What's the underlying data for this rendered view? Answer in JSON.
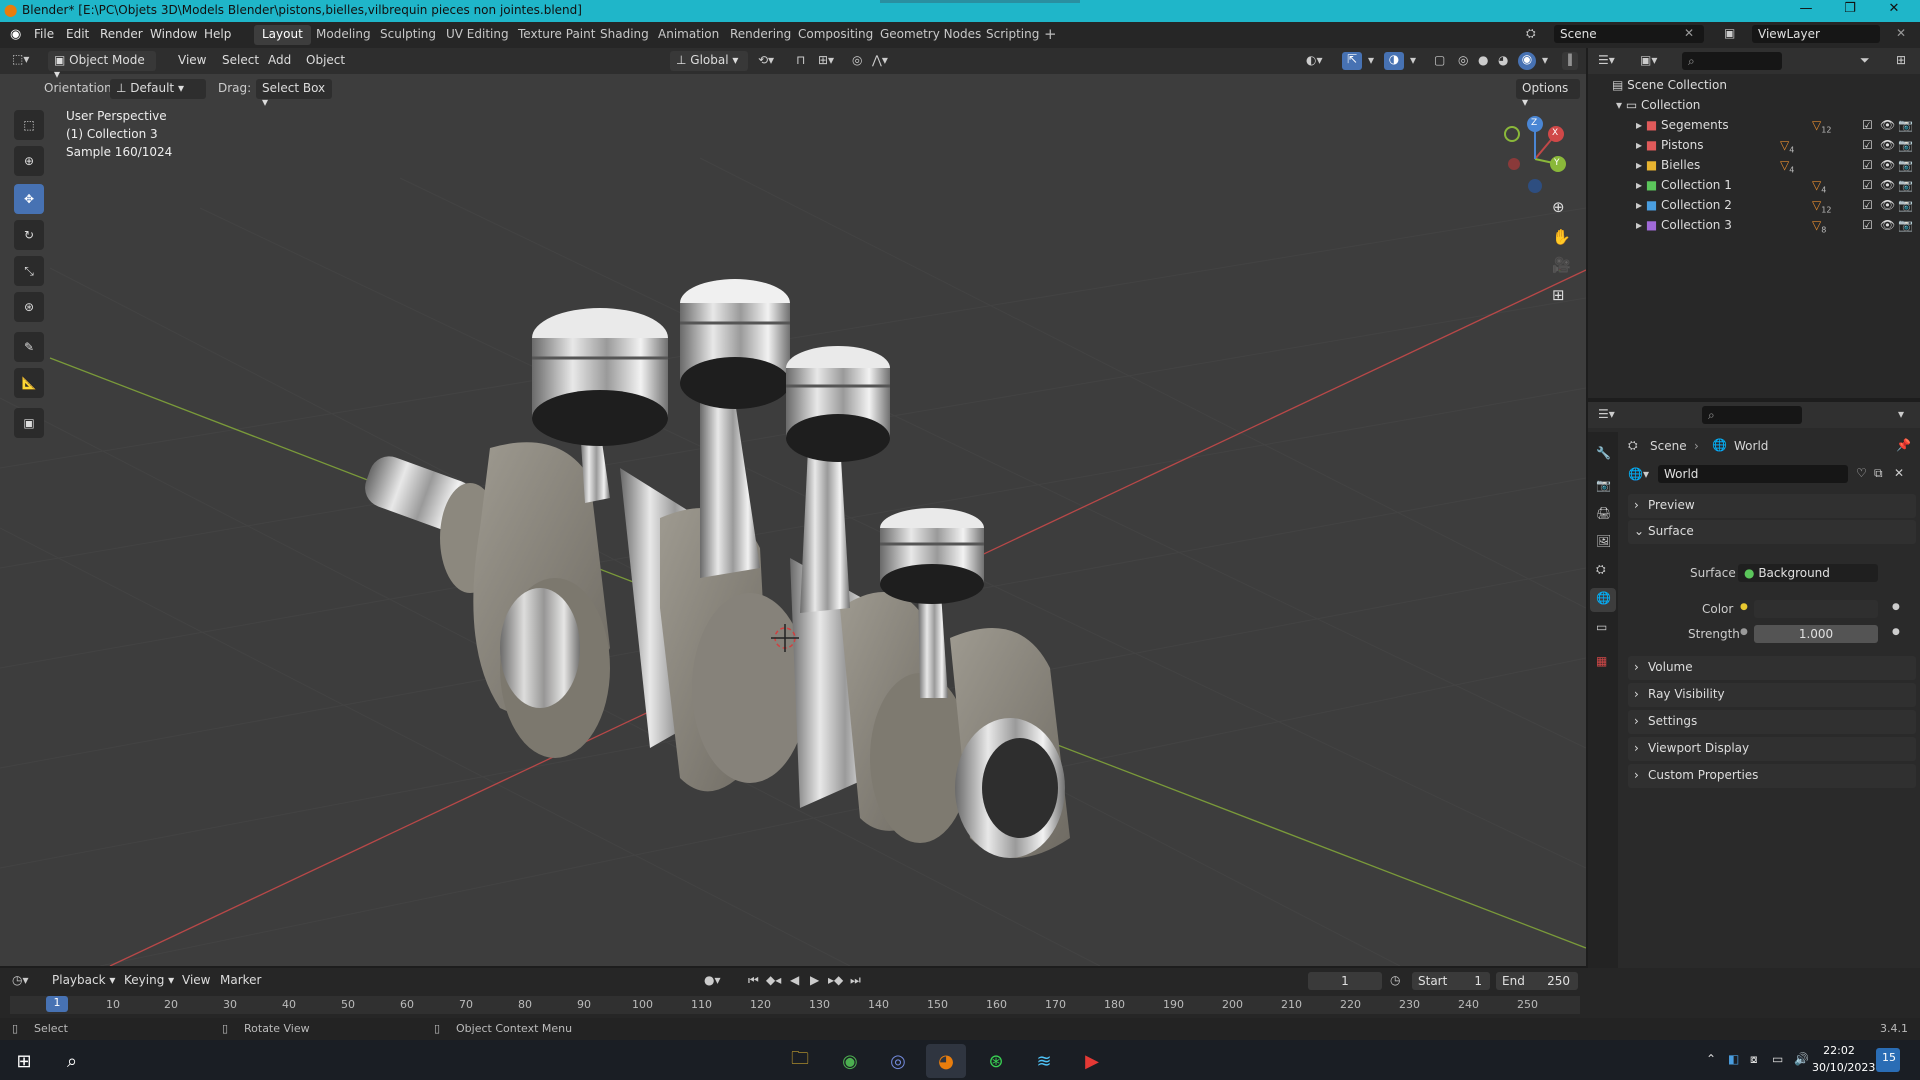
{
  "window": {
    "title": "Blender* [E:\\PC\\Objets 3D\\Models Blender\\pistons,bielles,vilbrequin pieces non jointes.blend]",
    "minimize": "—",
    "maximize": "❐",
    "close": "✕"
  },
  "menu": {
    "file": "File",
    "edit": "Edit",
    "render": "Render",
    "window": "Window",
    "help": "Help"
  },
  "workspaces": [
    "Layout",
    "Modeling",
    "Sculpting",
    "UV Editing",
    "Texture Paint",
    "Shading",
    "Animation",
    "Rendering",
    "Compositing",
    "Geometry Nodes",
    "Scripting"
  ],
  "topright": {
    "scene": "Scene",
    "view_layer": "ViewLayer"
  },
  "viewport_header": {
    "mode": "Object Mode",
    "view": "View",
    "select": "Select",
    "add": "Add",
    "object": "Object",
    "transform_orientation": "Global",
    "orientation_label": "Orientation:",
    "orientation_value": "Default",
    "drag_label": "Drag:",
    "drag_value": "Select Box",
    "options": "Options"
  },
  "viewport_overlay": {
    "perspective": "User Perspective",
    "collection": "(1) Collection 3",
    "sample": "Sample 160/1024"
  },
  "gizmo": {
    "x": "X",
    "y": "Y",
    "z": "Z"
  },
  "outliner": {
    "scene_collection": "Scene Collection",
    "collection": "Collection",
    "items": [
      {
        "name": "Segements",
        "count": "12",
        "color": "#e05a5a"
      },
      {
        "name": "Pistons",
        "count": "4",
        "color": "#e05a5a"
      },
      {
        "name": "Bielles",
        "count": "4",
        "color": "#e8b430"
      },
      {
        "name": "Collection 1",
        "count": "4",
        "color": "#5bc65b"
      },
      {
        "name": "Collection 2",
        "count": "12",
        "color": "#4a9ee0"
      },
      {
        "name": "Collection 3",
        "count": "8",
        "color": "#a06ad8"
      }
    ]
  },
  "properties": {
    "breadcrumb_scene": "Scene",
    "breadcrumb_world": "World",
    "world_name": "World",
    "sections": {
      "preview": "Preview",
      "surface": "Surface",
      "volume": "Volume",
      "ray_visibility": "Ray Visibility",
      "settings": "Settings",
      "viewport_display": "Viewport Display",
      "custom_properties": "Custom Properties"
    },
    "surface_label": "Surface",
    "surface_value": "Background",
    "color_label": "Color",
    "strength_label": "Strength",
    "strength_value": "1.000"
  },
  "timeline": {
    "playback": "Playback",
    "keying": "Keying",
    "view": "View",
    "marker": "Marker",
    "current_frame": "1",
    "start_label": "Start",
    "start_value": "1",
    "end_label": "End",
    "end_value": "250",
    "ruler": [
      "10",
      "20",
      "30",
      "40",
      "50",
      "60",
      "70",
      "80",
      "90",
      "100",
      "110",
      "120",
      "130",
      "140",
      "150",
      "160",
      "170",
      "180",
      "190",
      "200",
      "210",
      "220",
      "230",
      "240",
      "250"
    ],
    "playhead": "1"
  },
  "status": {
    "select": "Select",
    "rotate": "Rotate View",
    "context": "Object Context Menu",
    "version": "3.4.1"
  },
  "taskbar": {
    "time": "22:02",
    "date": "30/10/2023",
    "badge": "15"
  },
  "colors": {
    "accent": "#4772b3",
    "title_bar": "#1fb6c9"
  }
}
